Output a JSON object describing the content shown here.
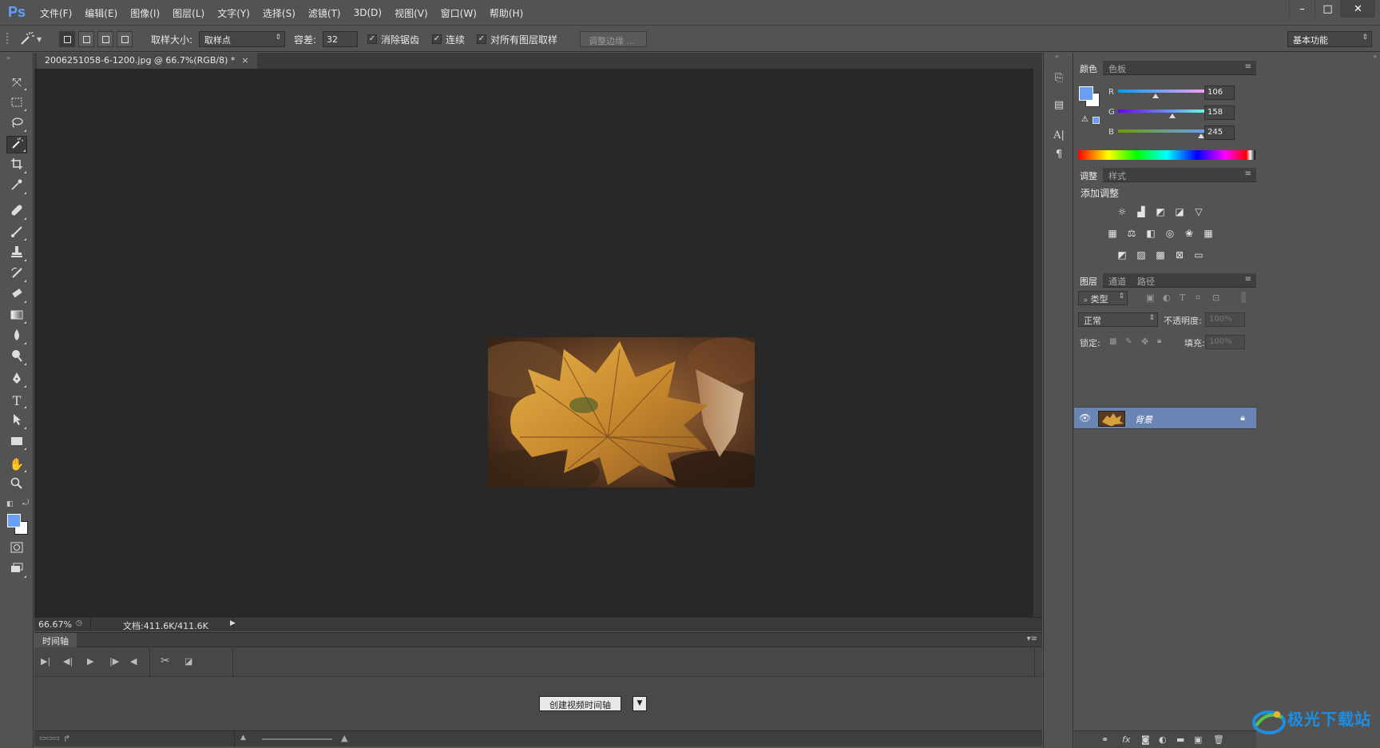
{
  "app": {
    "logo": "Ps",
    "menus": [
      "文件(F)",
      "编辑(E)",
      "图像(I)",
      "图层(L)",
      "文字(Y)",
      "选择(S)",
      "滤镜(T)",
      "3D(D)",
      "视图(V)",
      "窗口(W)",
      "帮助(H)"
    ],
    "window_controls": [
      "–",
      "□",
      "✕"
    ]
  },
  "options": {
    "tool_icon": "magic-wand-icon",
    "sample_size_label": "取样大小:",
    "sample_size_value": "取样点",
    "tolerance_label": "容差:",
    "tolerance_value": "32",
    "antialias_label": "消除锯齿",
    "contiguous_label": "连续",
    "sample_all_layers_label": "对所有图层取样",
    "refine_edge_label": "调整边缘 ...",
    "workspace_value": "基本功能"
  },
  "document": {
    "tab_title": "2006251058-6-1200.jpg @ 66.7%(RGB/8) *",
    "tab_close": "×",
    "zoom": "66.67%",
    "doc_info": "文档:411.6K/411.6K"
  },
  "timeline": {
    "tab_label": "时间轴",
    "create_button": "创建视频时间轴"
  },
  "color_panel": {
    "tabs": [
      "颜色",
      "色板"
    ],
    "foreground": "#6a9ef5",
    "background": "#ffffff",
    "channels": [
      {
        "name": "R",
        "value": "106",
        "fraction": 0.416
      },
      {
        "name": "G",
        "value": "158",
        "fraction": 0.62
      },
      {
        "name": "B",
        "value": "245",
        "fraction": 0.961
      }
    ]
  },
  "adjust_panel": {
    "tabs": [
      "调整",
      "样式"
    ],
    "title": "添加调整"
  },
  "layers_panel": {
    "tabs": [
      "图层",
      "通道",
      "路径"
    ],
    "filter_kind": "类型",
    "blend_mode": "正常",
    "opacity_label": "不透明度:",
    "opacity_value": "100%",
    "lock_label": "锁定:",
    "fill_label": "填充:",
    "fill_value": "100%",
    "layer_name": "背景"
  },
  "watermark": {
    "text": "极光下载站"
  },
  "colors": {
    "selected_layer": "#6a85b3",
    "canvas": "#282828",
    "ui_gray": "#535353"
  }
}
